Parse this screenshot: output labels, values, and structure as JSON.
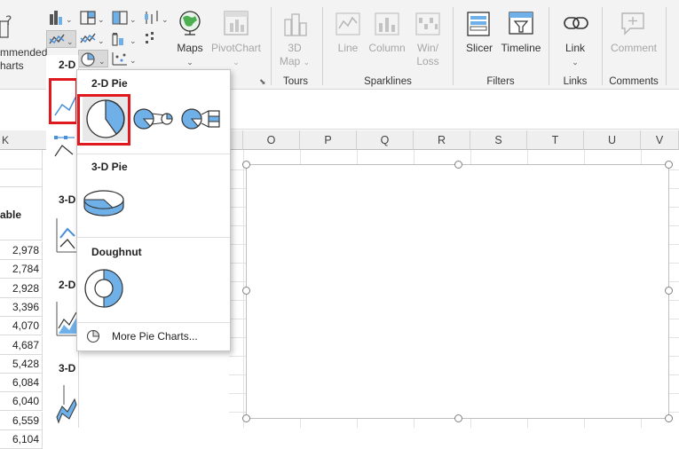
{
  "ribbon": {
    "recommended_partial": "mmended",
    "charts_partial": "harts",
    "maps": "Maps",
    "pivotchart": "PivotChart",
    "map3d_line1": "3D",
    "map3d_line2": "Map",
    "line": "Line",
    "column": "Column",
    "winloss_line1": "Win/",
    "winloss_line2": "Loss",
    "slicer": "Slicer",
    "timeline": "Timeline",
    "link": "Link",
    "comment": "Comment",
    "groups": {
      "tours": "Tours",
      "sparklines": "Sparklines",
      "filters": "Filters",
      "links": "Links",
      "comments": "Comments"
    }
  },
  "left_panel": {
    "header_partial": "2-D",
    "sections": [
      "3-D",
      "2-D",
      "3-D"
    ]
  },
  "sheet": {
    "col_left": "K",
    "columns": [
      "O",
      "P",
      "Q",
      "R",
      "S",
      "T",
      "U",
      "V"
    ],
    "partial_header": "able",
    "values": [
      "2,978",
      "2,784",
      "2,928",
      "3,396",
      "4,070",
      "4,687",
      "5,428",
      "6,084",
      "6,040",
      "6,559",
      "6,104"
    ]
  },
  "dropdown": {
    "section_2d": "2-D Pie",
    "section_3d": "3-D Pie",
    "section_doughnut": "Doughnut",
    "more_link": "More Pie Charts..."
  },
  "colors": {
    "accent_blue": "#6fb0e8",
    "highlight_red": "#e0191f"
  }
}
